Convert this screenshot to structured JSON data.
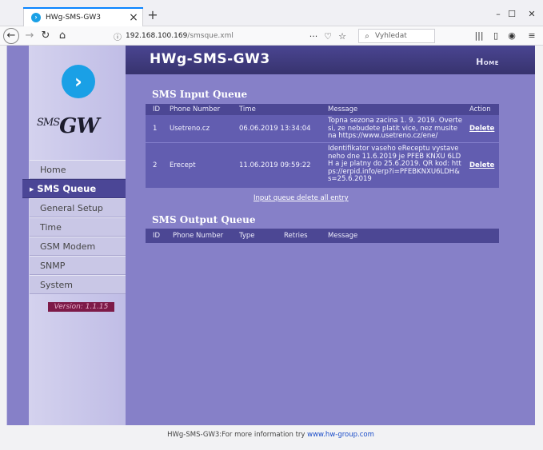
{
  "browser": {
    "tab_title": "HWg-SMS-GW3",
    "tab_close": "×",
    "new_tab": "+",
    "url_host": "192.168.100.169",
    "url_path": "/smsque.xml",
    "search_placeholder": "Vyhledat",
    "window_controls": {
      "minimize": "–",
      "maximize": "☐",
      "close": "✕"
    }
  },
  "header": {
    "title": "HWg-SMS-GW3",
    "home_link": "Home"
  },
  "logo": {
    "prefix": "SMS",
    "main": "GW"
  },
  "menu": {
    "items": [
      "Home",
      "SMS Queue",
      "General Setup",
      "Time",
      "GSM Modem",
      "SNMP",
      "System"
    ],
    "active_index": 1
  },
  "version": "Version: 1.1.15",
  "input_queue": {
    "title": "SMS Input Queue",
    "columns": [
      "ID",
      "Phone Number",
      "Time",
      "Message",
      "Action"
    ],
    "rows": [
      {
        "id": "1",
        "phone": "Usetreno.cz",
        "time": "06.06.2019 13:34:04",
        "message": "Topna sezona zacina 1. 9. 2019. Overte si, ze nebudete platit vice, nez musite na https://www.usetreno.cz/ene/",
        "action": "Delete"
      },
      {
        "id": "2",
        "phone": "Erecept",
        "time": "11.06.2019 09:59:22",
        "message": "Identifikator vaseho eReceptu vystavenehо dne 11.6.2019 je PFEB KNXU 6LDH a je platny do 25.6.2019. QR kod: https://erpid.info/erp?i=PFEBKNXU6LDH&s=25.6.2019",
        "action": "Delete"
      }
    ],
    "delete_all": "Input queue delete all entry"
  },
  "output_queue": {
    "title": "SMS Output Queue",
    "columns": [
      "ID",
      "Phone Number",
      "Type",
      "Retries",
      "Message"
    ]
  },
  "footer": {
    "text": "HWg-SMS-GW3:For more information try ",
    "link": "www.hw-group.com"
  }
}
